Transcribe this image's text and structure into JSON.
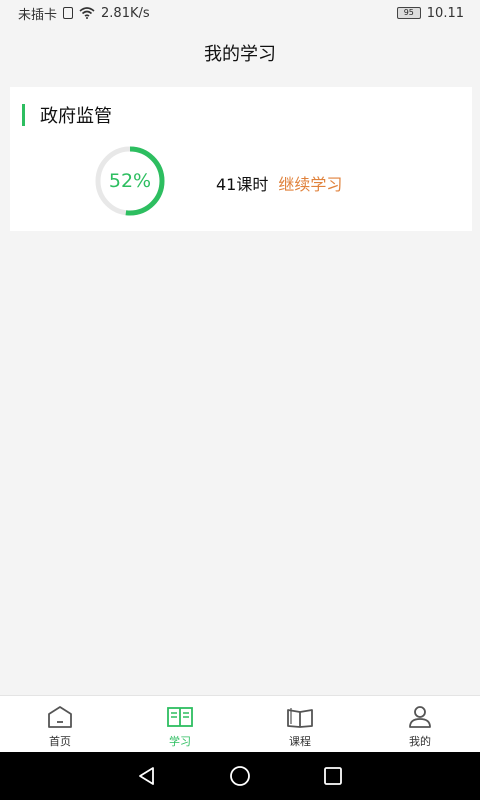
{
  "status_bar": {
    "carrier": "未插卡",
    "speed": "2.81K/s",
    "battery": "95",
    "time": "10.11"
  },
  "header": {
    "title": "我的学习"
  },
  "course_card": {
    "title": "政府监管",
    "progress_text": "52%",
    "progress_value": 0.52,
    "hours": "41课时",
    "continue_label": "继续学习"
  },
  "colors": {
    "accent_green": "#2dbe60",
    "link_orange": "#e0823c",
    "ring_track": "#e8e8e8"
  },
  "bottom_nav": {
    "items": [
      {
        "label": "首页",
        "icon": "home-icon",
        "active": false
      },
      {
        "label": "学习",
        "icon": "open-book-study-icon",
        "active": true
      },
      {
        "label": "课程",
        "icon": "book-icon",
        "active": false
      },
      {
        "label": "我的",
        "icon": "user-icon",
        "active": false
      }
    ]
  },
  "system_nav": {
    "icons": [
      "back-triangle-icon",
      "home-circle-icon",
      "recents-square-icon"
    ]
  }
}
